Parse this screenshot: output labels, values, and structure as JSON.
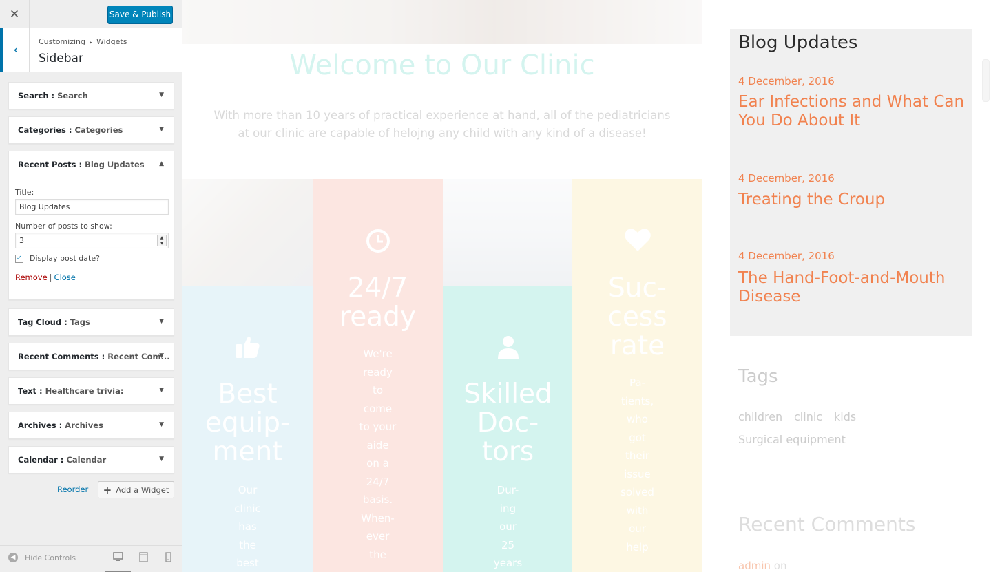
{
  "customizer": {
    "close_icon": "close-icon",
    "save_label": "Save & Publish",
    "breadcrumb": {
      "root": "Customizing",
      "section": "Widgets"
    },
    "section_title": "Sidebar",
    "widgets": [
      {
        "type": "Search",
        "title": "Search"
      },
      {
        "type": "Categories",
        "title": "Categories"
      },
      {
        "type": "Recent Posts",
        "title": "Blog Updates",
        "expanded": true
      },
      {
        "type": "Tag Cloud",
        "title": "Tags"
      },
      {
        "type": "Recent Comments",
        "title": "Recent Com..."
      },
      {
        "type": "Text",
        "title": "Healthcare trivia:"
      },
      {
        "type": "Archives",
        "title": "Archives"
      },
      {
        "type": "Calendar",
        "title": "Calendar"
      }
    ],
    "recent_posts_form": {
      "title_label": "Title:",
      "title_value": "Blog Updates",
      "number_label": "Number of posts to show:",
      "number_value": "3",
      "display_date_label": "Display post date?",
      "display_date_checked": true,
      "remove_label": "Remove",
      "separator": "|",
      "close_label": "Close"
    },
    "reorder_label": "Reorder",
    "add_widget_label": "Add a Widget",
    "footer": {
      "hide_controls_label": "Hide Controls",
      "devices": [
        "desktop-icon",
        "tablet-icon",
        "mobile-icon"
      ],
      "active_device": "desktop"
    },
    "accent_color": "#0073aa",
    "button_color": "#0085ba"
  },
  "preview": {
    "welcome_title": "Welcome to Our Clinic",
    "intro_text": "With more than 10 years of practical experience at hand, all of the pediatricians at our clinic are capable of helojng any child with any kind of a disease!",
    "features": [
      {
        "icon": "thumbs-up-icon",
        "heading": [
          "Best",
          "equip-",
          "ment"
        ],
        "text": [
          "Our",
          "clinic",
          "has",
          "the",
          "best"
        ],
        "color": "#a9d8e8"
      },
      {
        "icon": "clock-icon",
        "heading": [
          "24/7",
          "ready"
        ],
        "text": [
          "We're",
          "ready",
          "to",
          "come",
          "to your",
          "aide",
          "on a",
          "24/7",
          "basis.",
          "When-",
          "ever",
          "the"
        ],
        "color": "#f5a493"
      },
      {
        "icon": "user-icon",
        "heading": [
          "Skilled",
          "Doc-",
          "tors"
        ],
        "text": [
          "Dur-",
          "ing",
          "our",
          "25",
          "years"
        ],
        "color": "#67d6c4"
      },
      {
        "icon": "heart-icon",
        "heading": [
          "Suc-",
          "cess",
          "rate"
        ],
        "text": [
          "Pa-",
          "tients,",
          "who",
          "got",
          "their",
          "issue",
          "solved",
          "with",
          "our",
          "help"
        ],
        "color": "#f6e39b"
      }
    ],
    "blog_widget": {
      "title": "Blog Updates",
      "posts": [
        {
          "date": "4 December, 2016",
          "title": "Ear Infections and What Can You Do About It"
        },
        {
          "date": "4 December, 2016",
          "title": "Treating the Croup"
        },
        {
          "date": "4 December, 2016",
          "title": "The Hand-Foot-and-Mouth Disease"
        }
      ],
      "link_color": "#f1824f"
    },
    "tags_widget": {
      "title": "Tags",
      "tags": [
        "children",
        "clinic",
        "kids",
        "Surgical equipment"
      ]
    },
    "recent_comments_widget": {
      "title": "Recent Comments",
      "first_author": "admin",
      "first_connector": "on"
    }
  }
}
